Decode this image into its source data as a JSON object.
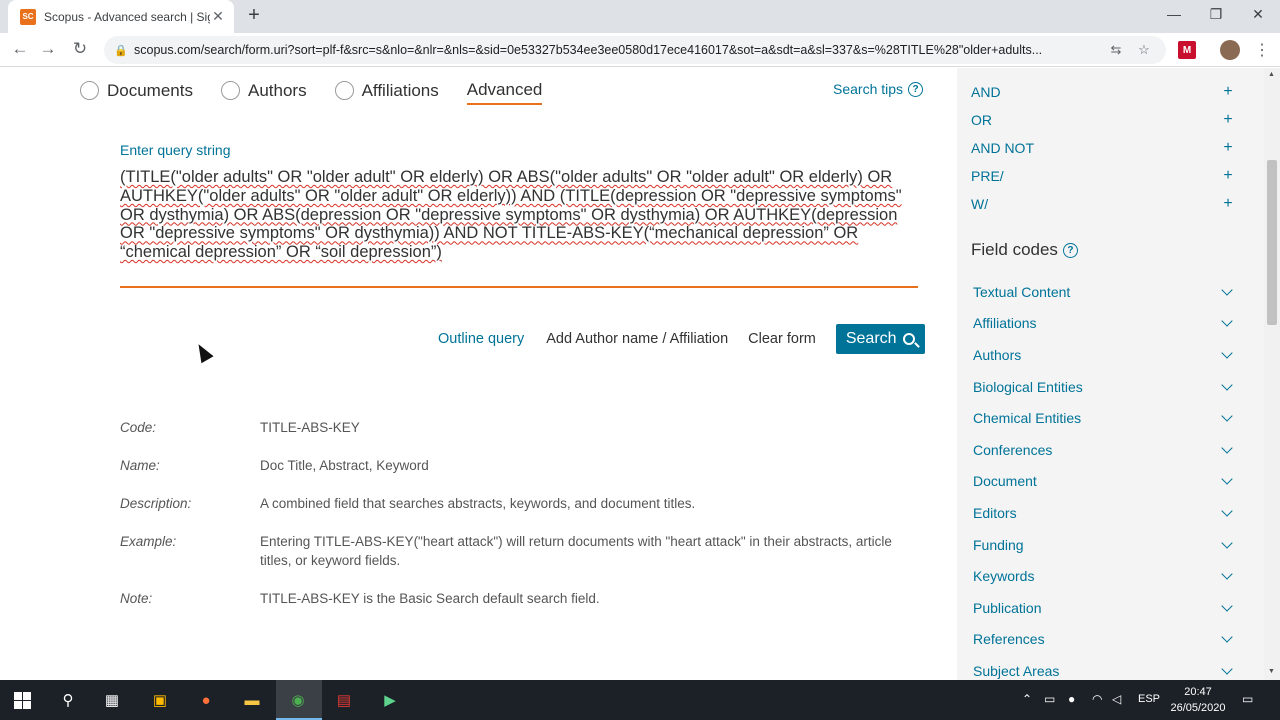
{
  "browser": {
    "tab_title": "Scopus - Advanced search | Sign",
    "favicon_text": "SC",
    "url": "scopus.com/search/form.uri?sort=plf-f&src=s&nlo=&nlr=&nls=&sid=0e53327b534ee3ee0580d17ece416017&sot=a&sdt=a&sl=337&s=%28TITLE%28\"older+adults..."
  },
  "search_tabs": {
    "documents": "Documents",
    "authors": "Authors",
    "affiliations": "Affiliations",
    "advanced": "Advanced"
  },
  "search_tips": "Search tips",
  "query": {
    "label": "Enter query string",
    "text": "(TITLE(\"older adults\" OR \"older adult\" OR elderly) OR ABS(\"older adults\" OR \"older adult\" OR elderly) OR AUTHKEY(\"older adults\" OR \"older adult\" OR elderly)) AND (TITLE(depression OR \"depressive symptoms\" OR dysthymia) OR ABS(depression OR \"depressive symptoms\" OR dysthymia) OR AUTHKEY(depression OR \"depressive symptoms\" OR dysthymia)) AND NOT TITLE-ABS-KEY(“mechanical depression” OR “chemical depression” OR “soil depression”)"
  },
  "actions": {
    "outline": "Outline query",
    "add_author": "Add Author name / Affiliation",
    "clear": "Clear form",
    "search": "Search"
  },
  "field_info": {
    "code_key": "Code:",
    "code_val": "TITLE-ABS-KEY",
    "name_key": "Name:",
    "name_val": "Doc Title, Abstract, Keyword",
    "desc_key": "Description:",
    "desc_val": "A combined field that searches abstracts, keywords, and document titles.",
    "example_key": "Example:",
    "example_val": "Entering TITLE-ABS-KEY(\"heart attack\") will return documents with \"heart attack\" in their abstracts, article titles, or keyword fields.",
    "note_key": "Note:",
    "note_val": "TITLE-ABS-KEY is the Basic Search default search field."
  },
  "operators": [
    "AND",
    "OR",
    "AND NOT",
    "PRE/",
    "W/"
  ],
  "field_codes": {
    "heading": "Field codes",
    "items": [
      "Textual Content",
      "Affiliations",
      "Authors",
      "Biological Entities",
      "Chemical Entities",
      "Conferences",
      "Document",
      "Editors",
      "Funding",
      "Keywords",
      "Publication",
      "References",
      "Subject Areas"
    ]
  },
  "taskbar": {
    "language": "ESP",
    "time": "20:47",
    "date": "26/05/2020"
  },
  "colors": {
    "accent_orange": "#e9711c",
    "link_blue": "#007398",
    "button_blue": "#007398"
  }
}
